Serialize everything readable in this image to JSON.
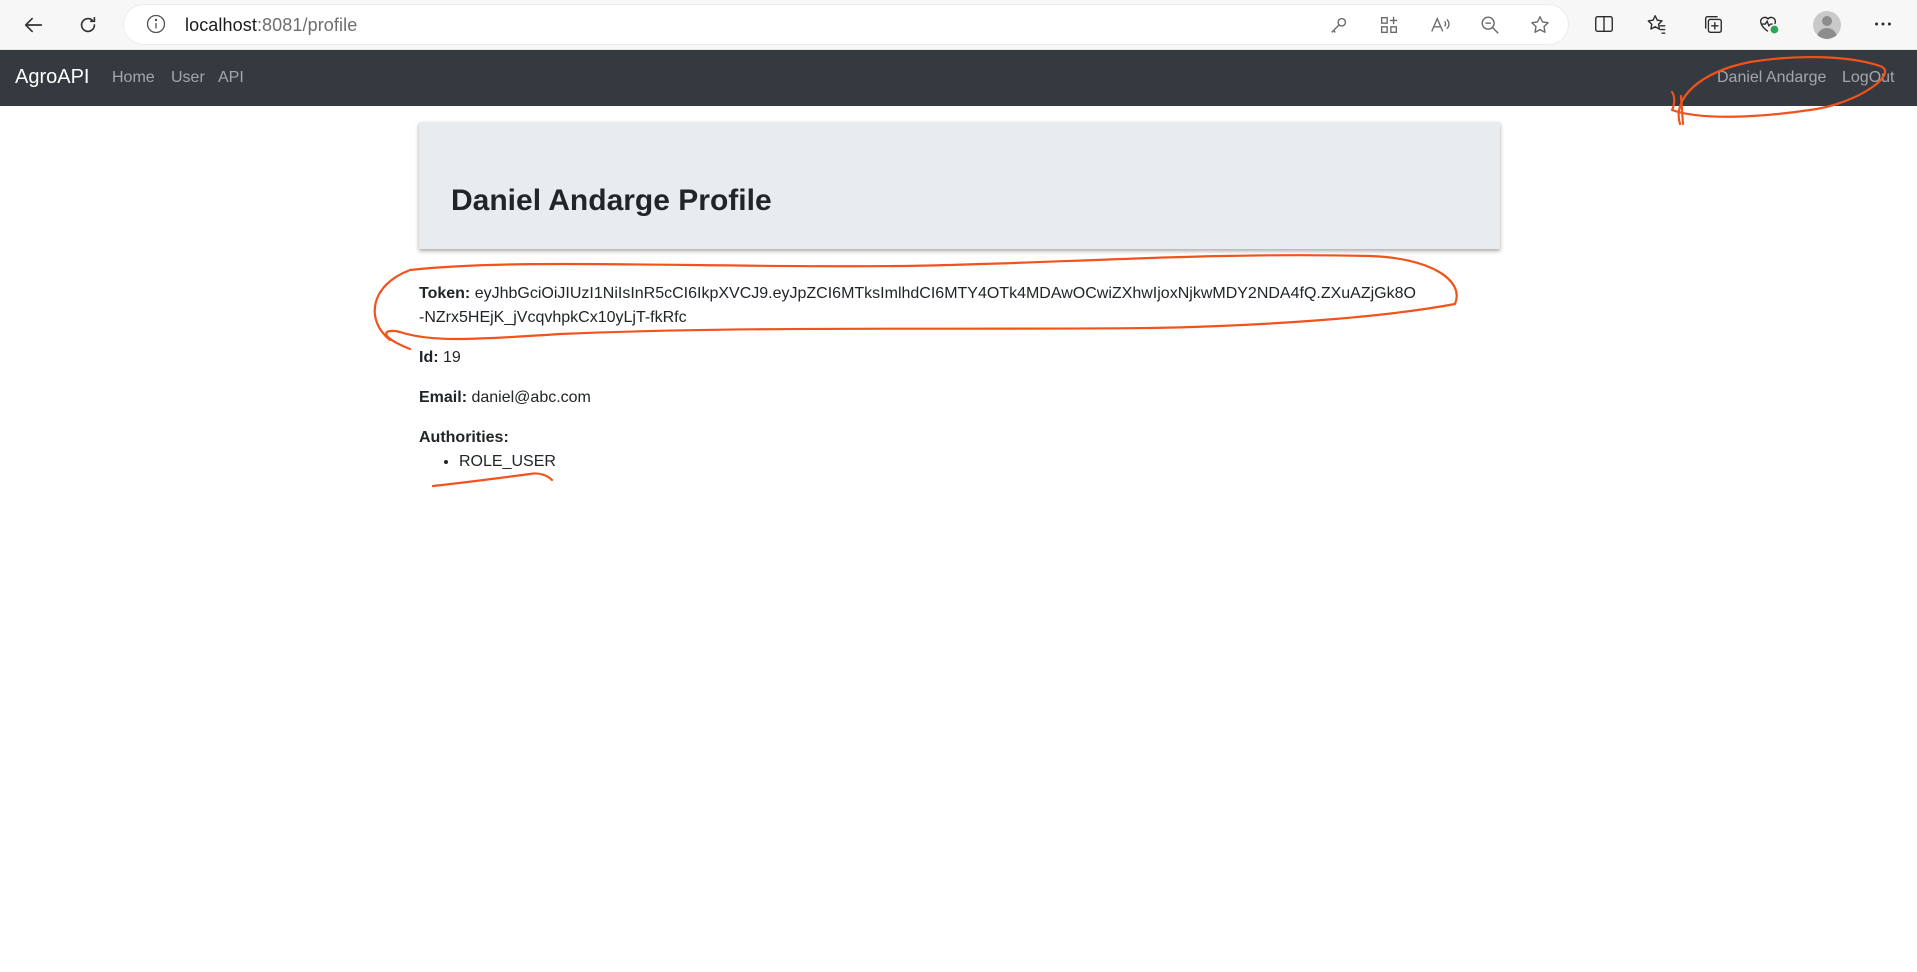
{
  "browser": {
    "url_host": "localhost",
    "url_path": ":8081/profile",
    "icons": [
      "back-icon",
      "refresh-icon",
      "info-icon",
      "key-icon",
      "apps-icon",
      "read-aloud-icon",
      "zoom-out-icon",
      "favorite-star-icon",
      "split-screen-icon",
      "favorites-icon",
      "collections-icon",
      "browser-essentials-icon",
      "profile-avatar-icon",
      "more-menu-icon"
    ]
  },
  "navbar": {
    "brand": "AgroAPI",
    "links": [
      "Home",
      "User",
      "API"
    ],
    "user_name": "Daniel Andarge",
    "logout": "LogOut"
  },
  "profile": {
    "title_name": "Daniel Andarge",
    "title_suffix": "Profile",
    "token_label": "Token:",
    "token_value": "eyJhbGciOiJIUzI1NiIsInR5cCI6IkpXVCJ9.eyJpZCI6MTksImlhdCI6MTY4OTk4MDAwOCwiZXhwIjoxNjkwMDY2NDA4fQ.ZXuAZjGk8O-NZrx5HEjK_jVcqvhpkCx10yLjT-fkRfc",
    "id_label": "Id:",
    "id_value": "19",
    "email_label": "Email:",
    "email_value": "daniel@abc.com",
    "authorities_label": "Authorities:",
    "authorities": [
      "ROLE_USER"
    ]
  },
  "colors": {
    "navbar_bg": "#343a40",
    "jumbotron_bg": "#e9ecef",
    "annotation": "#f2521b"
  }
}
